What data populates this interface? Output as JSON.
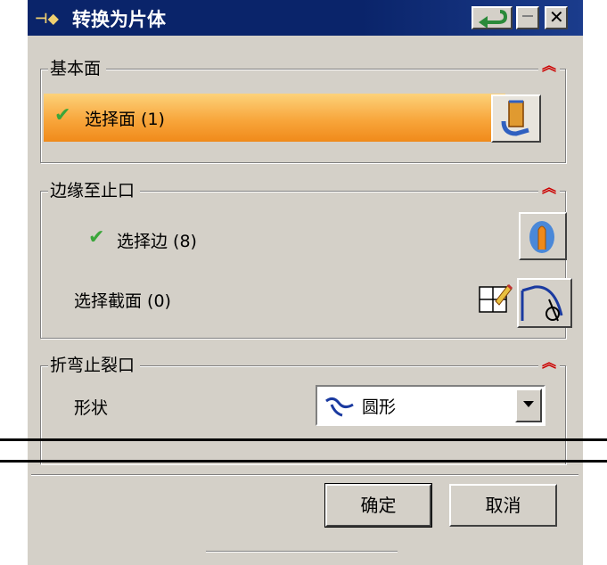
{
  "window": {
    "title": "转换为片体",
    "pin_icon": "pin-icon"
  },
  "groups": {
    "base_face": {
      "title": "基本面",
      "select_label": "选择面 (1)"
    },
    "edge_to_relief": {
      "title": "边缘至止口",
      "select_edge_label": "选择边 (8)",
      "select_section_label": "选择截面 (0)"
    },
    "bend_relief": {
      "title": "折弯止裂口",
      "shape_label": "形状",
      "shape_value": "圆形"
    }
  },
  "footer": {
    "ok_label": "确定",
    "cancel_label": "取消"
  },
  "colors": {
    "title_bar": "#0a246a",
    "dialog_bg": "#d4d0c8",
    "selected_row": "#f8a63c",
    "collapse_arrow": "#cc0000",
    "check": "#3aa63a"
  }
}
